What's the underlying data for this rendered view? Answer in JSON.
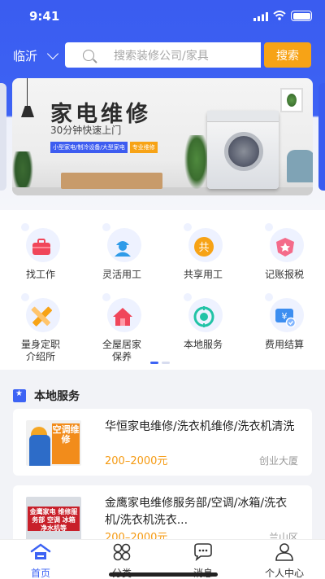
{
  "status": {
    "time": "9:41"
  },
  "header": {
    "city": "临沂",
    "search_placeholder": "搜索装修公司/家具",
    "search_button": "搜索"
  },
  "banner": {
    "title": "家电维修",
    "subtitle": "30分钟快速上门",
    "tags": [
      "小型家电/制冷设备/大型家电",
      "专业维修"
    ]
  },
  "services": [
    {
      "label": "找工作",
      "icon": "briefcase-icon",
      "color": "#f0465a"
    },
    {
      "label": "灵活用工",
      "icon": "worker-icon",
      "color": "#2f9be8"
    },
    {
      "label": "共享用工",
      "icon": "share-coin-icon",
      "color": "#f7a316"
    },
    {
      "label": "记账报税",
      "icon": "badge-icon",
      "color": "#f46b8a"
    },
    {
      "label": "量身定职\n介绍所",
      "icon": "pencil-ruler-icon",
      "color": "#f7a316"
    },
    {
      "label": "全屋居家\n保养",
      "icon": "house-icon",
      "color": "#f0465a"
    },
    {
      "label": "本地服务",
      "icon": "target-icon",
      "color": "#21c3a6"
    },
    {
      "label": "费用结算",
      "icon": "payment-icon",
      "color": "#3d8ef0"
    }
  ],
  "section": {
    "title": "本地服务"
  },
  "listings": [
    {
      "title": "华恒家电维修/洗衣机维修/洗衣机清洗",
      "price": "200–2000元",
      "location": "创业大厦",
      "thumb_text": "空调维修"
    },
    {
      "title": "金鹰家电维修服务部/空调/冰箱/洗衣机/洗衣机洗衣...",
      "price": "200–2000元",
      "location": "兰山区",
      "thumb_text": "金鹰家电 维修服务部 空调 冰箱 净水机等"
    }
  ],
  "tabbar": [
    {
      "label": "首页",
      "icon": "home-icon",
      "active": true
    },
    {
      "label": "分类",
      "icon": "category-icon",
      "active": false
    },
    {
      "label": "消息",
      "icon": "message-icon",
      "active": false
    },
    {
      "label": "个人中心",
      "icon": "profile-icon",
      "active": false
    }
  ],
  "colors": {
    "primary": "#3d63f4",
    "accent": "#f7a316",
    "price": "#f59a12"
  }
}
